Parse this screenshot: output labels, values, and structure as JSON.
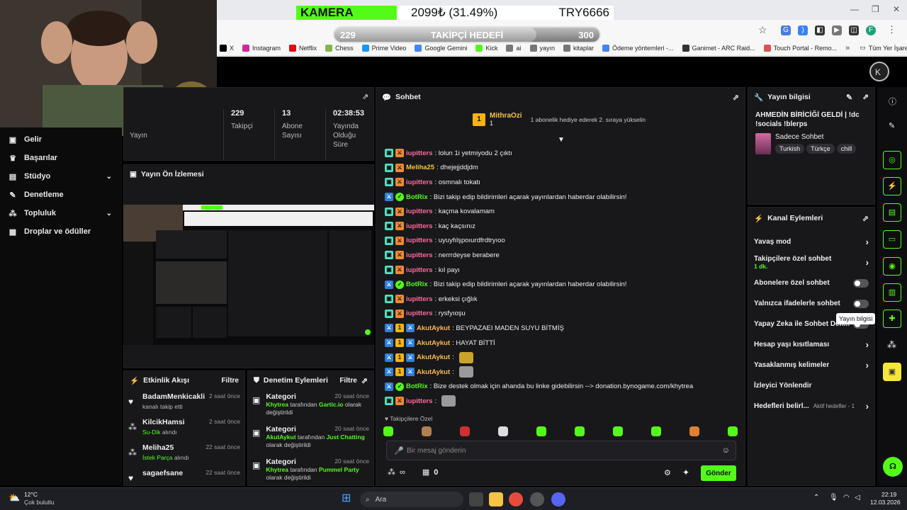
{
  "overlay": {
    "camera_label": "KAMERA",
    "price_text": "2099₺ (31.49%)",
    "currency_pair": "TRY6666",
    "goal_current": "229",
    "goal_label": "TAKİPÇİ HEDEFİ",
    "goal_target": "300",
    "goal_progress": 0.763
  },
  "bookmarks": [
    {
      "label": "X",
      "color": "#000000"
    },
    {
      "label": "Instagram",
      "color": "#d6249f"
    },
    {
      "label": "Netflix",
      "color": "#e50914"
    },
    {
      "label": "Chess",
      "color": "#81b64c"
    },
    {
      "label": "Prime Video",
      "color": "#1399ff"
    },
    {
      "label": "Google Gemini",
      "color": "#4285f4"
    },
    {
      "label": "Kick",
      "color": "#53fc18"
    },
    {
      "label": "ai",
      "color": "#777777"
    },
    {
      "label": "yayın",
      "color": "#777777"
    },
    {
      "label": "kitaplar",
      "color": "#777777"
    },
    {
      "label": "Ödeme yöntemleri -...",
      "color": "#4285f4"
    },
    {
      "label": "Ganimet - ARC Raid...",
      "color": "#333333"
    },
    {
      "label": "Touch Portal - Remo...",
      "color": "#e05050"
    }
  ],
  "bookmarks_more": "»",
  "bookmarks_all": "Tüm Yer İşaretleri",
  "nav": {
    "items": [
      {
        "label": "Gelir",
        "icon": "wallet-icon"
      },
      {
        "label": "Başarılar",
        "icon": "trophy-icon"
      },
      {
        "label": "Stüdyo",
        "icon": "studio-icon"
      },
      {
        "label": "Denetleme",
        "icon": "wrench-icon"
      },
      {
        "label": "Topluluk",
        "icon": "people-icon"
      },
      {
        "label": "Droplar ve ödüller",
        "icon": "gift-icon"
      }
    ],
    "partial_label": "Yayın"
  },
  "stats": {
    "followers_value": "229",
    "followers_label": "Takipçi",
    "subs_value": "13",
    "subs_label": "Abone Sayısı",
    "uptime_value": "02:38:53",
    "uptime_label": "Yayında Olduğu Süre"
  },
  "preview": {
    "title": "Yayın Ön İzlemesi"
  },
  "activity": {
    "title": "Etkinlik Akışı",
    "filter": "Filtre",
    "events": [
      {
        "name": "BadamMenkicakli",
        "time": "2 saat önce",
        "sub_plain": "kanalı takip etti",
        "sub_highlight": ""
      },
      {
        "name": "KilcikHamsi",
        "time": "2 saat önce",
        "sub_plain": " alındı",
        "sub_highlight": "Su-Dik"
      },
      {
        "name": "Meliha25",
        "time": "22 saat önce",
        "sub_plain": " alındı",
        "sub_highlight": "İstek Parça"
      },
      {
        "name": "sagaefsane",
        "time": "22 saat önce",
        "sub_plain": "",
        "sub_highlight": ""
      }
    ]
  },
  "moderation": {
    "title": "Denetim Eylemleri",
    "filter": "Filtre",
    "actions": [
      {
        "type": "Kategori",
        "time": "20 saat önce",
        "who": "Khytrea",
        "mid": " tarafından ",
        "what": "Gartic.io",
        "tail": " olarak değiştirildi"
      },
      {
        "type": "Kategori",
        "time": "20 saat önce",
        "who": "AkutAykut",
        "mid": " tarafından ",
        "what": "Just Chatting",
        "tail": " olarak değiştirildi"
      },
      {
        "type": "Kategori",
        "time": "20 saat önce",
        "who": "Khytrea",
        "mid": " tarafından ",
        "what": "Pummel Party",
        "tail": " olarak değiştirildi"
      }
    ]
  },
  "chat": {
    "title": "Sohbet",
    "pinned_user": "MithraOzi",
    "pinned_count": "1",
    "pinned_text": "1 abonelik hediye ederek 2. sıraya yükselin",
    "messages": [
      {
        "user": "iupitters",
        "color": "pink",
        "text": ": lolun 1i yetmiyodu 2 çıktı",
        "emote": false
      },
      {
        "user": "Meliha25",
        "color": "yellow",
        "text": ": dhejejjddjdm",
        "emote": false
      },
      {
        "user": "iupitters",
        "color": "pink",
        "text": ": osmnalı tokatı",
        "emote": false
      },
      {
        "user": "BotRix",
        "color": "green",
        "text": ": Bizi takip edip bildirimleri açarak yayınlardan haberdar olabilirsin!",
        "emote": false
      },
      {
        "user": "iupitters",
        "color": "pink",
        "text": ": kaçma kovalamam",
        "emote": false
      },
      {
        "user": "iupitters",
        "color": "pink",
        "text": ": kaç kaçsınız",
        "emote": false
      },
      {
        "user": "iupitters",
        "color": "pink",
        "text": ": uyuyfılşpoıurdfrdtryıoo",
        "emote": false
      },
      {
        "user": "iupitters",
        "color": "pink",
        "text": ": nerrrdeyse berabere",
        "emote": false
      },
      {
        "user": "iupitters",
        "color": "pink",
        "text": ": kıl payı",
        "emote": false
      },
      {
        "user": "BotRix",
        "color": "green",
        "text": ": Bizi takip edip bildirimleri açarak yayınlardan haberdar olabilirsin!",
        "emote": false
      },
      {
        "user": "iupitters",
        "color": "pink",
        "text": ": erkeksi çığlık",
        "emote": false
      },
      {
        "user": "iupitters",
        "color": "pink",
        "text": ": rysfyıoşu",
        "emote": false
      },
      {
        "user": "AkutAykut",
        "color": "orange",
        "text": ": BEYPAZAEI MADEN SUYU BİTMİŞ",
        "emote": false
      },
      {
        "user": "AkutAykut",
        "color": "orange",
        "text": ": HAYAT BİTTİ",
        "emote": false
      },
      {
        "user": "AkutAykut",
        "color": "orange",
        "text": ":",
        "emote": true
      },
      {
        "user": "AkutAykut",
        "color": "orange",
        "text": ":",
        "emote": true
      },
      {
        "user": "BotRix",
        "color": "green",
        "text": ": Bize destek olmak için ahanda bu linke gidebilirsin --> donation.bynogame.com/khytrea",
        "emote": false
      },
      {
        "user": "iupitters",
        "color": "pink",
        "text": ":",
        "emote": true
      }
    ],
    "followers_only": "Takipçilere Özel",
    "input_placeholder": "Bir mesaj gönderin",
    "points_value": "0",
    "infinity": "∞",
    "send_label": "Gönder"
  },
  "stream_info": {
    "title": "Yayın bilgisi",
    "stream_title": "AHMEDİN BİRİCİĞİ GELDİ | !dc !socials !blerps",
    "category": "Sadece Sohbet",
    "tags": [
      "Turkish",
      "Türkçe",
      "chill"
    ]
  },
  "channel_actions": {
    "title": "Kanal Eylemleri",
    "rows": [
      {
        "label": "Yavaş mod",
        "kind": "chevron",
        "sub": ""
      },
      {
        "label": "Takipçilere özel sohbet",
        "kind": "chevron",
        "sub": "1 dk."
      },
      {
        "label": "Abonelere özel sohbet",
        "kind": "toggle",
        "sub": ""
      },
      {
        "label": "Yalnızca ifadelerle sohbet",
        "kind": "toggle",
        "sub": ""
      },
      {
        "label": "Yapay Zeka ile Sohbet Den...",
        "kind": "toggle",
        "sub": ""
      },
      {
        "label": "Hesap yaşı kısıtlaması",
        "kind": "chevron",
        "sub": ""
      },
      {
        "label": "Yasaklanmış kelimeler",
        "kind": "chevron",
        "sub": ""
      },
      {
        "label": "İzleyici Yönlendir",
        "kind": "none",
        "sub": ""
      },
      {
        "label": "Hedefleri belirl...",
        "kind": "chevron",
        "sub": "Aktif hedefler - 1"
      }
    ]
  },
  "tooltip": "Yayın bilgisi",
  "taskbar": {
    "weather_temp": "12°C",
    "weather_desc": "Çok bulutlu",
    "search": "Ara",
    "time": "22:19",
    "date": "12.03.2026"
  },
  "colors": {
    "kick_green": "#53fc18",
    "panel": "#18181b"
  }
}
